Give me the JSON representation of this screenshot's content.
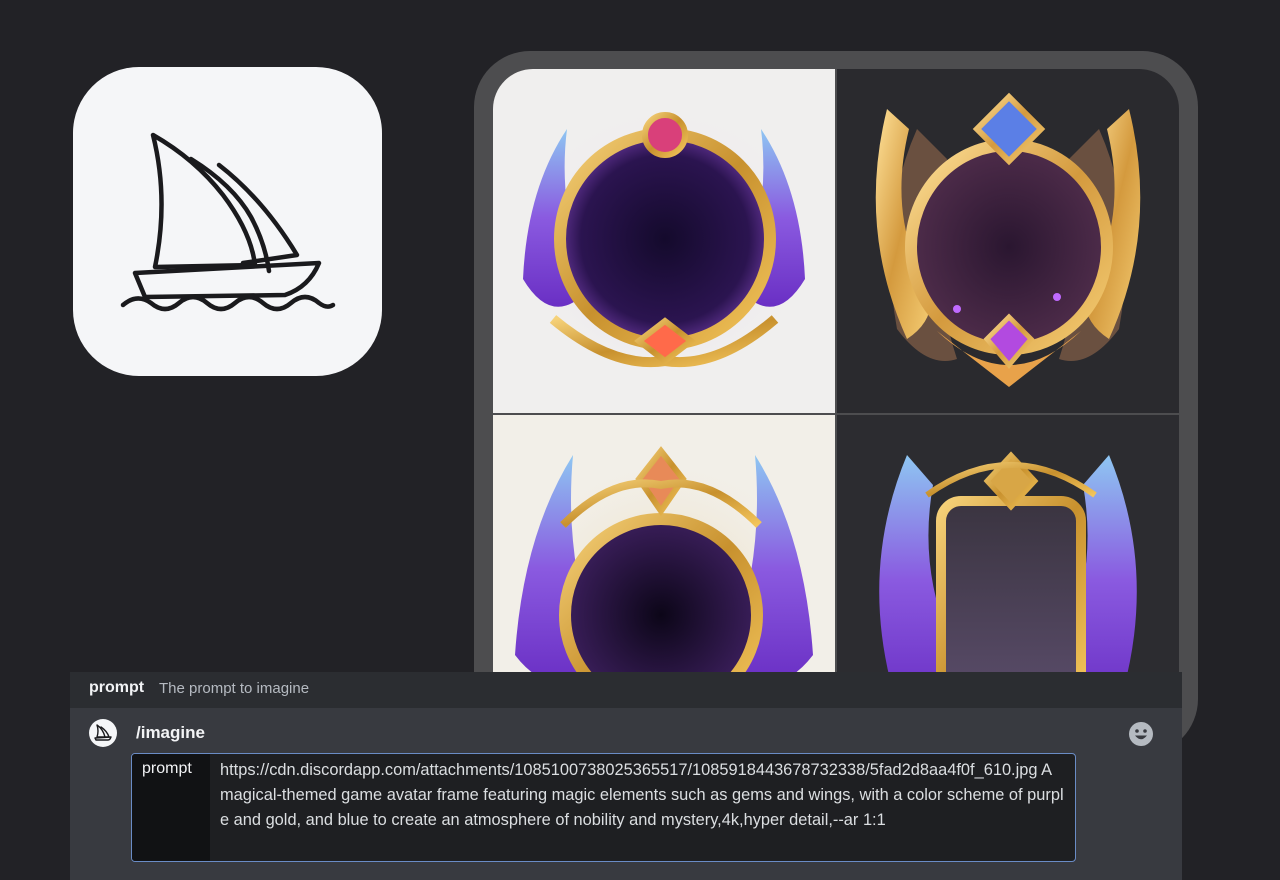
{
  "app": {
    "icon": "midjourney-sailboat-icon"
  },
  "images": {
    "tiles": [
      {
        "name": "image-tile-1",
        "background": "#f0efee"
      },
      {
        "name": "image-tile-2",
        "background": "#2a2a2e"
      },
      {
        "name": "image-tile-3",
        "background": "#f2efe8"
      },
      {
        "name": "image-tile-4",
        "background": "#2c2c30"
      }
    ]
  },
  "hint": {
    "option_name": "prompt",
    "option_desc": "The prompt to imagine"
  },
  "command": {
    "name": "/imagine",
    "emoji_icon": "smiley-emoji-icon",
    "option_label": "prompt",
    "value": "https://cdn.discordapp.com/attachments/1085100738025365517/1085918443678732338/5fad2d8aa4f0f_610.jpg A magical-themed game avatar frame featuring magic elements such as gems and wings, with a color scheme of purple and gold, and blue to create an atmosphere of nobility and mystery,4k,hyper detail,--ar 1:1"
  },
  "colors": {
    "background": "#222226",
    "panel": "#383a40",
    "focus_border": "#6a8cc6"
  }
}
